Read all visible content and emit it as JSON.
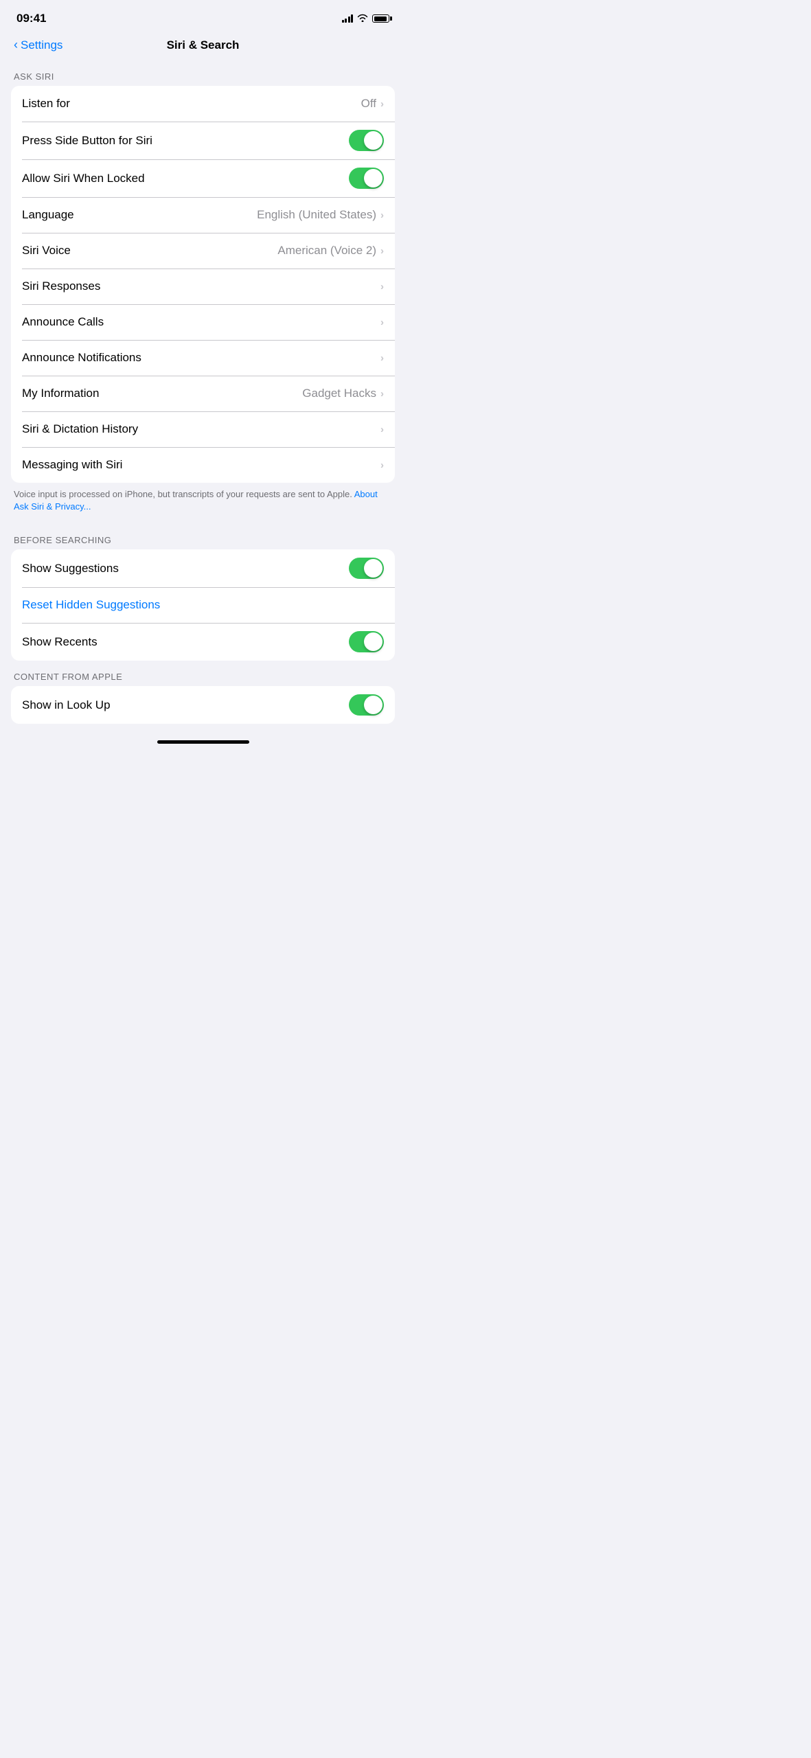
{
  "statusBar": {
    "time": "09:41"
  },
  "header": {
    "backLabel": "Settings",
    "title": "Siri & Search"
  },
  "askSiri": {
    "sectionLabel": "ASK SIRI",
    "rows": [
      {
        "id": "listen-for",
        "label": "Listen for",
        "value": "Off",
        "type": "chevron"
      },
      {
        "id": "press-side-button",
        "label": "Press Side Button for Siri",
        "value": null,
        "type": "toggle",
        "enabled": true
      },
      {
        "id": "allow-locked",
        "label": "Allow Siri When Locked",
        "value": null,
        "type": "toggle",
        "enabled": true
      },
      {
        "id": "language",
        "label": "Language",
        "value": "English (United States)",
        "type": "chevron"
      },
      {
        "id": "siri-voice",
        "label": "Siri Voice",
        "value": "American (Voice 2)",
        "type": "chevron"
      },
      {
        "id": "siri-responses",
        "label": "Siri Responses",
        "value": null,
        "type": "chevron"
      },
      {
        "id": "announce-calls",
        "label": "Announce Calls",
        "value": null,
        "type": "chevron"
      },
      {
        "id": "announce-notifications",
        "label": "Announce Notifications",
        "value": null,
        "type": "chevron"
      },
      {
        "id": "my-information",
        "label": "My Information",
        "value": "Gadget Hacks",
        "type": "chevron"
      },
      {
        "id": "dictation-history",
        "label": "Siri & Dictation History",
        "value": null,
        "type": "chevron"
      },
      {
        "id": "messaging-with-siri",
        "label": "Messaging with Siri",
        "value": null,
        "type": "chevron"
      }
    ],
    "footerText": "Voice input is processed on iPhone, but transcripts of your requests are sent to Apple.",
    "footerLink": "About Ask Siri & Privacy..."
  },
  "beforeSearching": {
    "sectionLabel": "BEFORE SEARCHING",
    "rows": [
      {
        "id": "show-suggestions",
        "label": "Show Suggestions",
        "value": null,
        "type": "toggle",
        "enabled": true
      },
      {
        "id": "reset-hidden-suggestions",
        "label": "Reset Hidden Suggestions",
        "value": null,
        "type": "link"
      },
      {
        "id": "show-recents",
        "label": "Show Recents",
        "value": null,
        "type": "toggle",
        "enabled": true
      }
    ]
  },
  "contentFromApple": {
    "sectionLabel": "CONTENT FROM APPLE",
    "rows": [
      {
        "id": "show-in-look-up",
        "label": "Show in Look Up",
        "value": null,
        "type": "toggle",
        "enabled": true
      }
    ]
  },
  "icons": {
    "backChevron": "‹",
    "chevronRight": "›"
  }
}
